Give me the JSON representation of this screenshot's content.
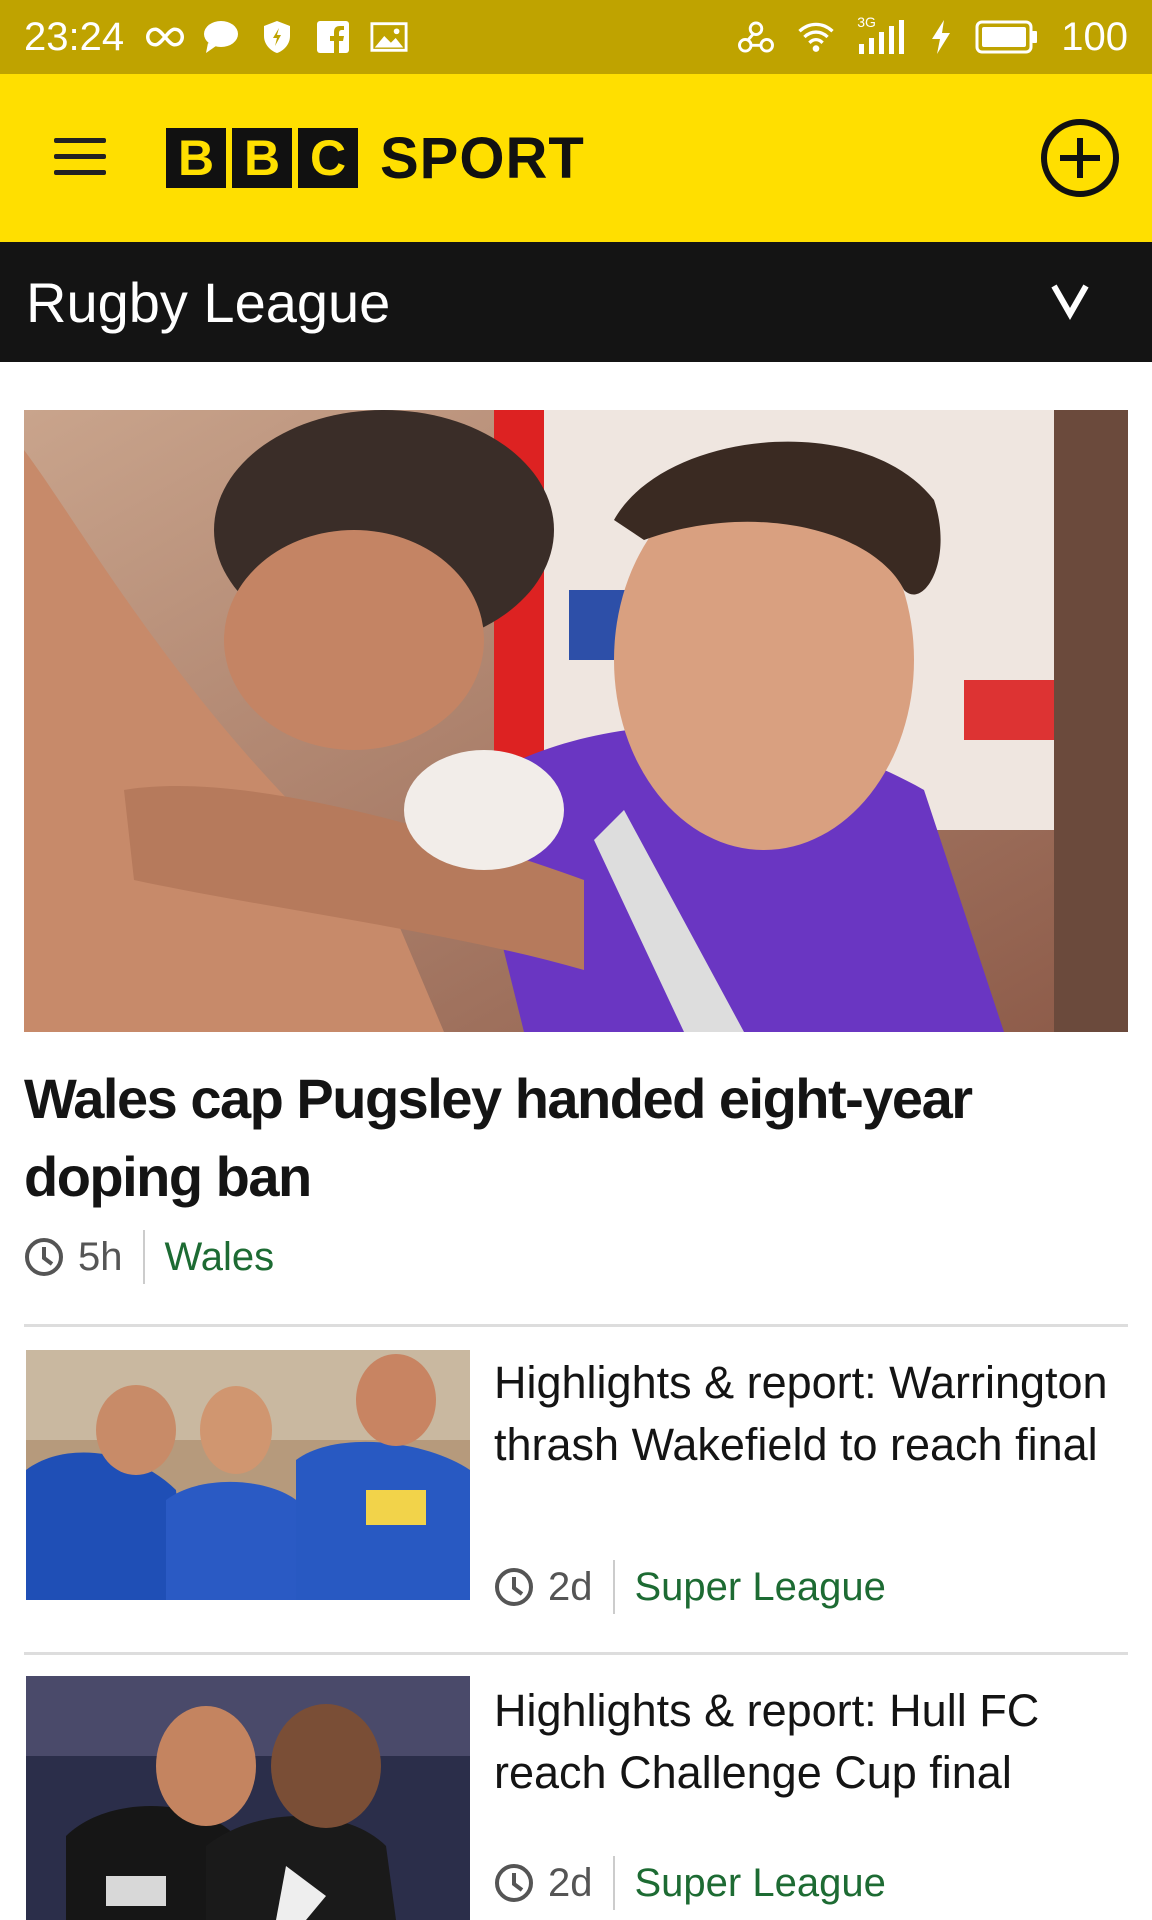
{
  "status_bar": {
    "time": "23:24",
    "network": "3G",
    "battery": "100",
    "left_icons": [
      "infinity-icon",
      "chat-bubble-icon",
      "shield-icon",
      "facebook-icon",
      "image-icon"
    ],
    "right_icons": [
      "link-icon",
      "wifi-icon",
      "signal-icon",
      "charging-icon",
      "battery-icon"
    ]
  },
  "header": {
    "logo_letters": [
      "B",
      "B",
      "C"
    ],
    "logo_word": "SPORT",
    "bg_color": "#ffdf00"
  },
  "section": {
    "title": "Rugby League"
  },
  "hero": {
    "title": "Wales cap Pugsley handed eight-year doping ban",
    "time": "5h",
    "section": "Wales"
  },
  "stories": [
    {
      "title": "Highlights & report: Warrington thrash Wakefield to reach final",
      "time": "2d",
      "section": "Super League"
    },
    {
      "title": "Highlights & report: Hull FC reach Challenge Cup final",
      "time": "2d",
      "section": "Super League"
    }
  ]
}
